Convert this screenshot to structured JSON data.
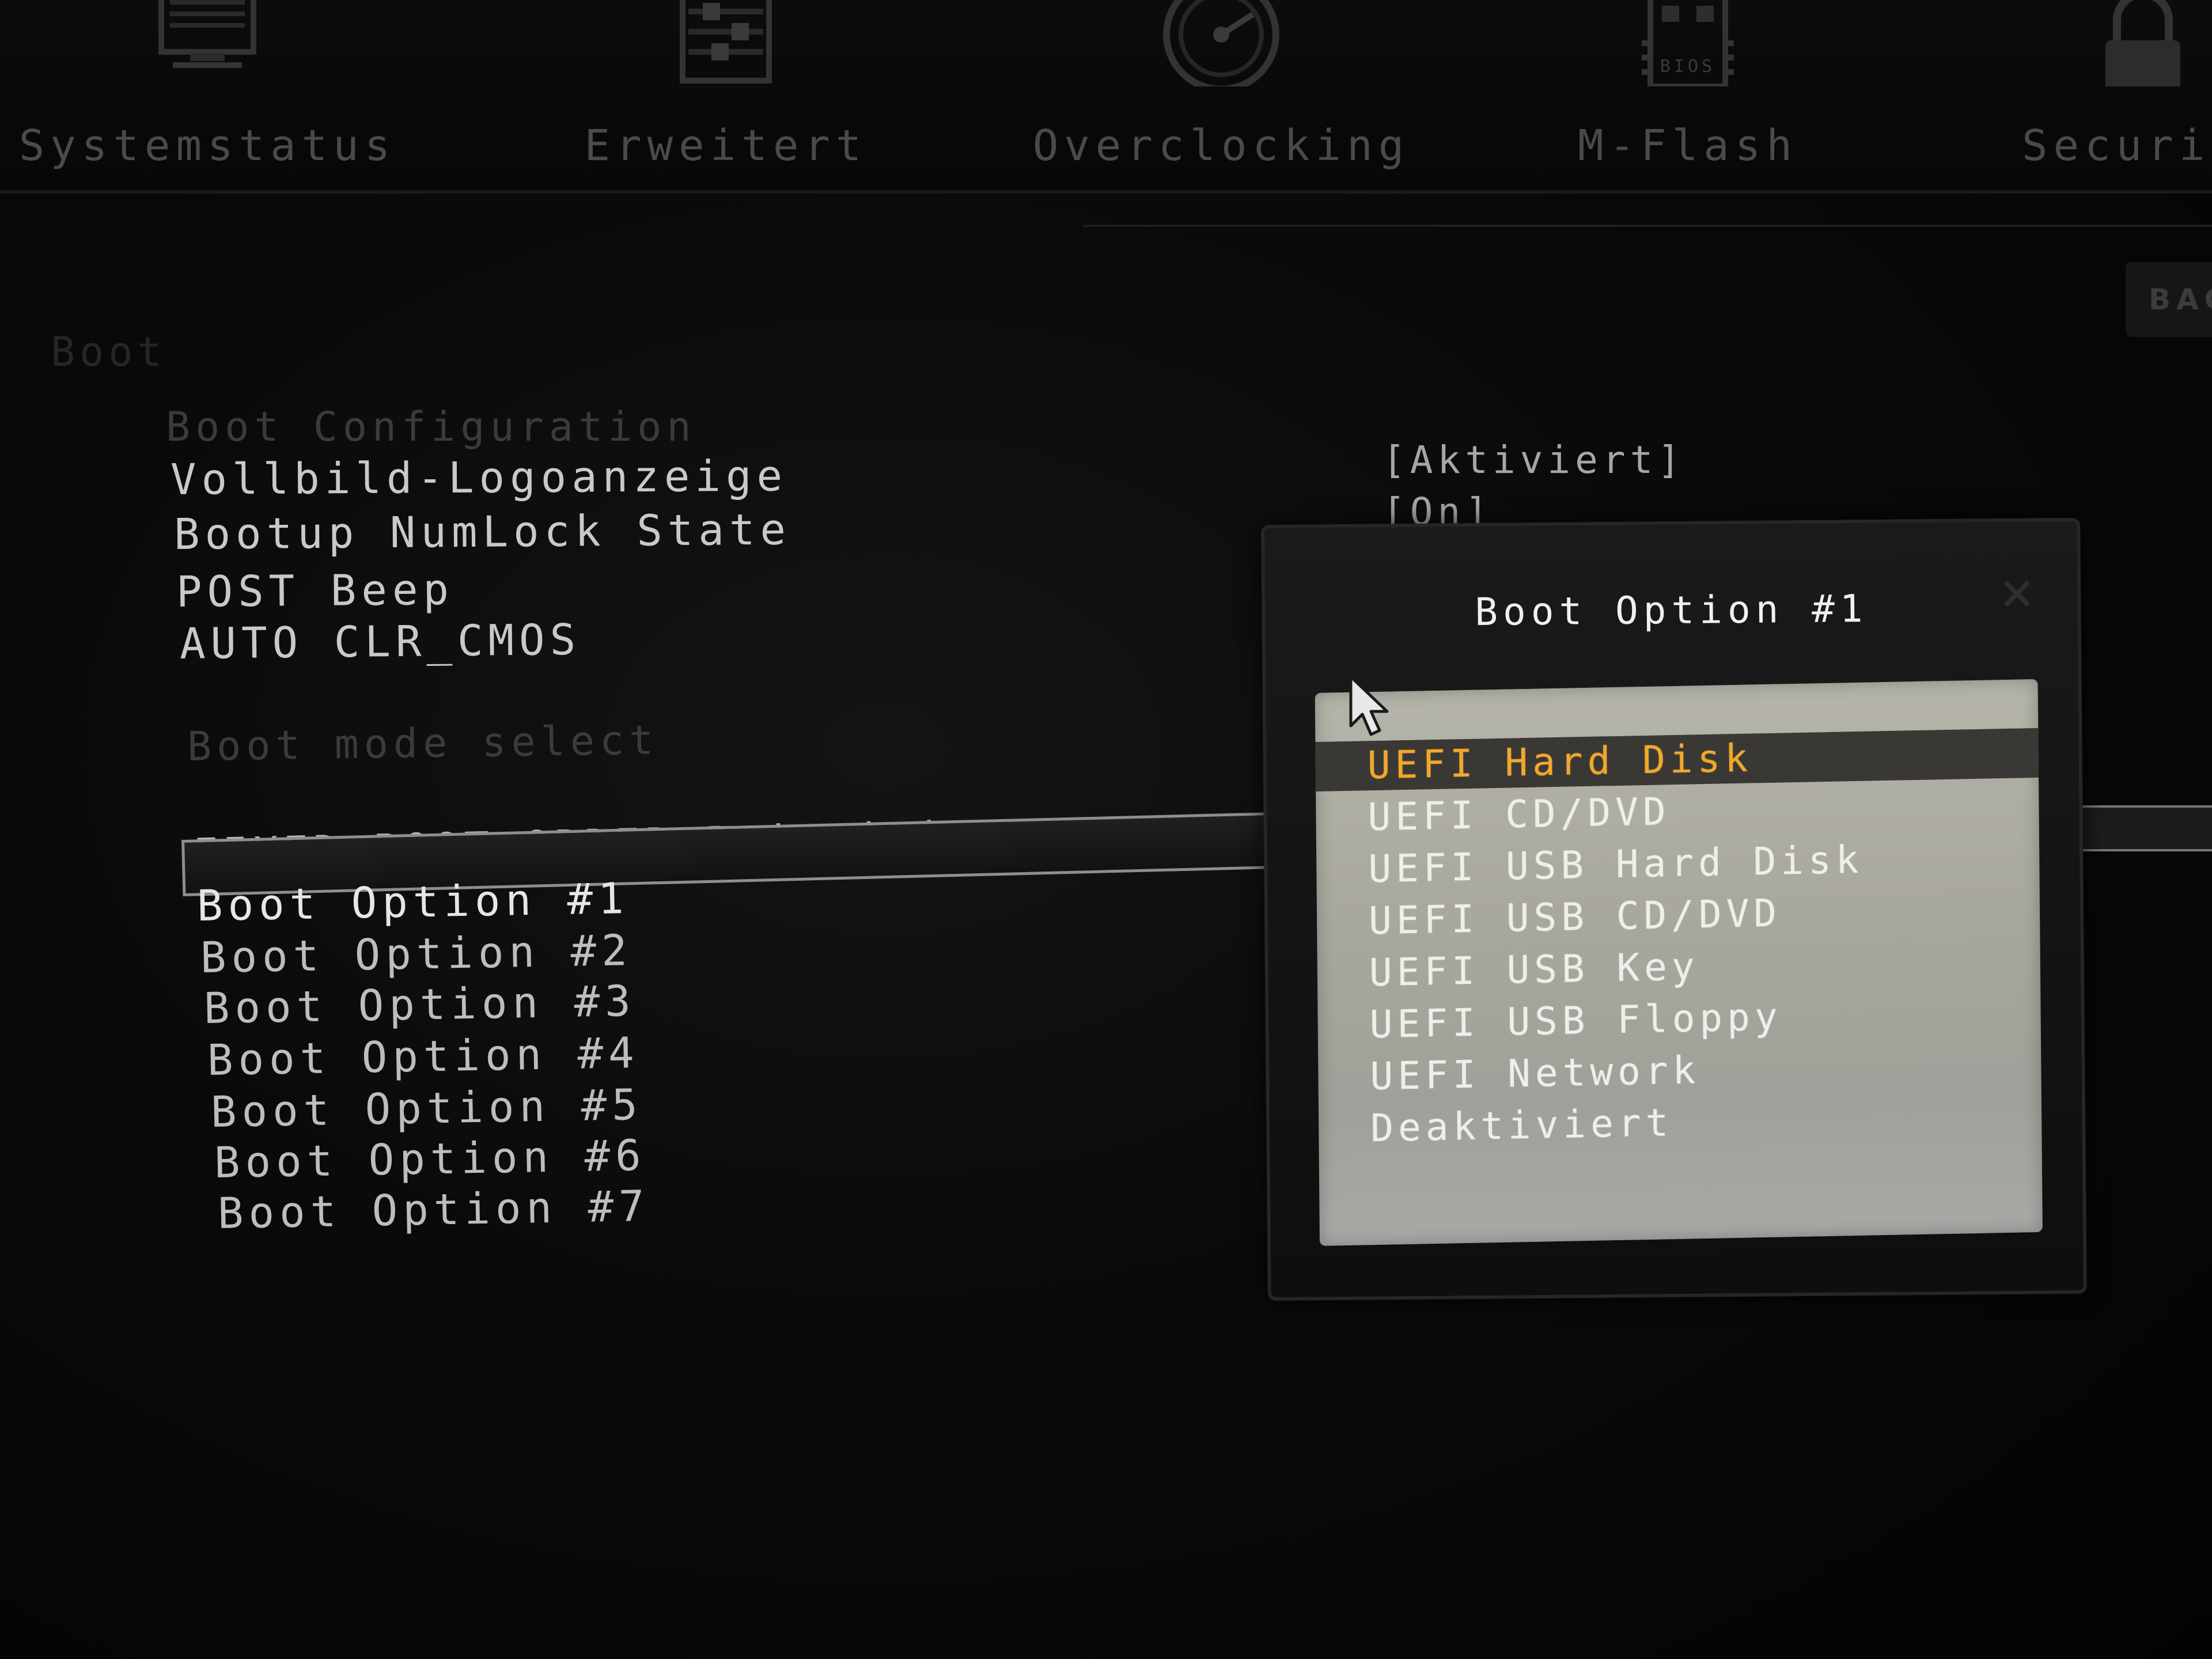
{
  "nav": {
    "tabs": [
      {
        "label": "Systemstatus",
        "icon": "monitor-icon"
      },
      {
        "label": "Erweitert",
        "icon": "sliders-icon"
      },
      {
        "label": "Overclocking",
        "icon": "speedometer-icon"
      },
      {
        "label": "M-Flash",
        "icon": "bios-chip-icon",
        "icon_text": "BIOS"
      },
      {
        "label": "Security",
        "icon": "padlock-icon"
      }
    ],
    "back_button": "BAC"
  },
  "panel": {
    "section_title": "Boot",
    "boot_configuration": {
      "header": "Boot Configuration",
      "items": [
        {
          "label": "Vollbild-Logoanzeige",
          "value": "[Aktiviert]"
        },
        {
          "label": "Bootup NumLock State",
          "value": "[On]"
        },
        {
          "label": "POST Beep"
        },
        {
          "label": "AUTO CLR_CMOS"
        }
      ]
    },
    "boot_mode_header": "Boot mode select",
    "priorities": {
      "header": "FIXED BOOT ORDER Priorities",
      "items": [
        "Boot Option #1",
        "Boot Option #2",
        "Boot Option #3",
        "Boot Option #4",
        "Boot Option #5",
        "Boot Option #6",
        "Boot Option #7"
      ],
      "selected_index": 0
    }
  },
  "popup": {
    "title": "Boot Option #1",
    "close_icon": "close-icon",
    "options": [
      "UEFI Hard Disk",
      "UEFI CD/DVD",
      "UEFI USB Hard Disk",
      "UEFI USB CD/DVD",
      "UEFI USB Key",
      "UEFI USB Floppy",
      "UEFI Network",
      "Deaktiviert"
    ],
    "selected_index": 0
  },
  "colors": {
    "background": "#050505",
    "text": "#c9c9c9",
    "selected_option_text": "#f3a827",
    "selected_option_bg": "#3a3835",
    "list_bg": "#aeada4"
  },
  "pointer": "mouse-cursor-icon"
}
